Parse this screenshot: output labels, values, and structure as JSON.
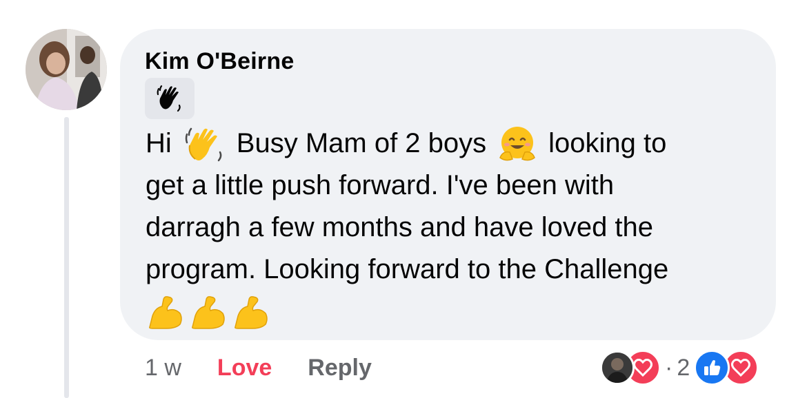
{
  "comment": {
    "author": "Kim O'Beirne",
    "badge_icon": "waving-hand-icon",
    "lines": [
      [
        "Hi ",
        " Busy Mam of 2 boys ",
        " looking to"
      ],
      "get a little push forward. I've been with",
      "darragh a few months and have loved the",
      "program. Looking forward to the Challenge"
    ],
    "line1_part1": "Hi",
    "line1_part2": "Busy Mam of 2 boys",
    "line1_part3": "looking to",
    "line2": "get a little push forward. I've been with",
    "line3": "darragh a few months and have loved the",
    "line4": "program. Looking forward to the Challenge",
    "trailing_emojis": [
      "flexed-biceps",
      "flexed-biceps",
      "flexed-biceps"
    ]
  },
  "meta": {
    "time": "1 w",
    "love_label": "Love",
    "reply_label": "Reply"
  },
  "reactions": {
    "separator": "·",
    "count": "2",
    "types": [
      "love",
      "like",
      "love"
    ]
  },
  "colors": {
    "bubble": "#f0f2f5",
    "love": "#f33e58",
    "like": "#1877f2",
    "secondary_text": "#65676b"
  }
}
